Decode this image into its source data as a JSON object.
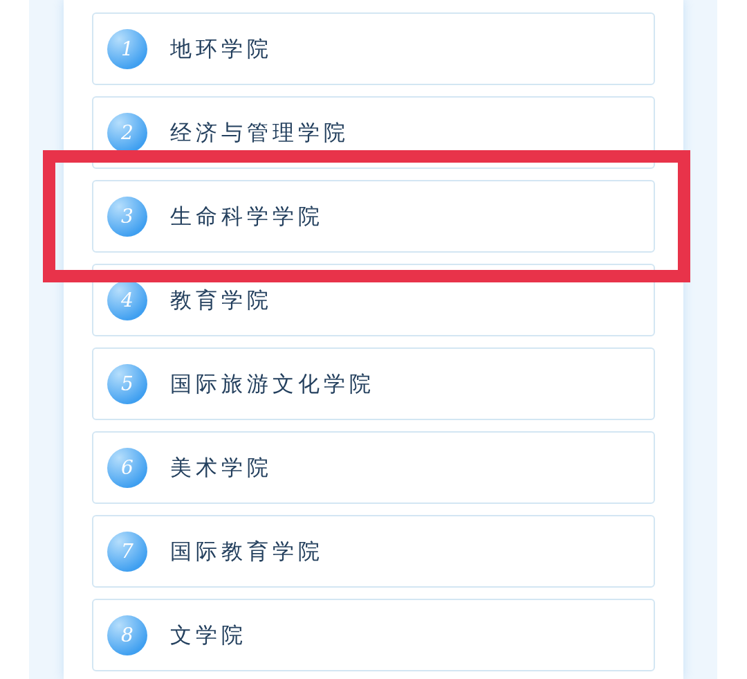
{
  "colleges": [
    {
      "number": "1",
      "name": "地环学院",
      "highlighted": false
    },
    {
      "number": "2",
      "name": "经济与管理学院",
      "highlighted": false
    },
    {
      "number": "3",
      "name": "生命科学学院",
      "highlighted": true
    },
    {
      "number": "4",
      "name": "教育学院",
      "highlighted": false
    },
    {
      "number": "5",
      "name": "国际旅游文化学院",
      "highlighted": false
    },
    {
      "number": "6",
      "name": "美术学院",
      "highlighted": false
    },
    {
      "number": "7",
      "name": "国际教育学院",
      "highlighted": false
    },
    {
      "number": "8",
      "name": "文学院",
      "highlighted": false
    }
  ]
}
